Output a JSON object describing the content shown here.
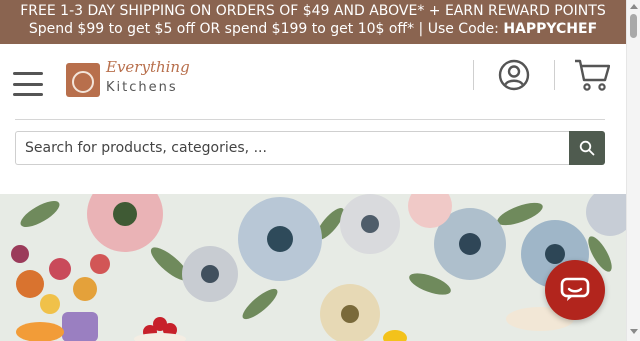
{
  "promo": {
    "line1": "FREE 1-3 DAY SHIPPING ON ORDERS OF $49 AND ABOVE* + EARN REWARD POINTS",
    "line2_prefix": "Spend $99 to get $5 off OR spend $199 to get 10$ off* | Use Code: ",
    "code": "HAPPYCHEF"
  },
  "header": {
    "menu_icon": "hamburger-menu-icon",
    "logo_line1": "Everything",
    "logo_line2": "Kitchens",
    "account_icon": "user-account-icon",
    "cart_icon": "shopping-cart-icon"
  },
  "search": {
    "placeholder": "Search for products, categories, ...",
    "button_icon": "search-icon"
  },
  "hero": {
    "description_icon": "floral-kitchen-banner-image"
  },
  "chat": {
    "icon": "chat-bubble-icon"
  },
  "colors": {
    "promo_bg": "#8a6450",
    "brand": "#b86f4c",
    "search_button": "#4f5b4f",
    "chat": "#b2251d"
  }
}
